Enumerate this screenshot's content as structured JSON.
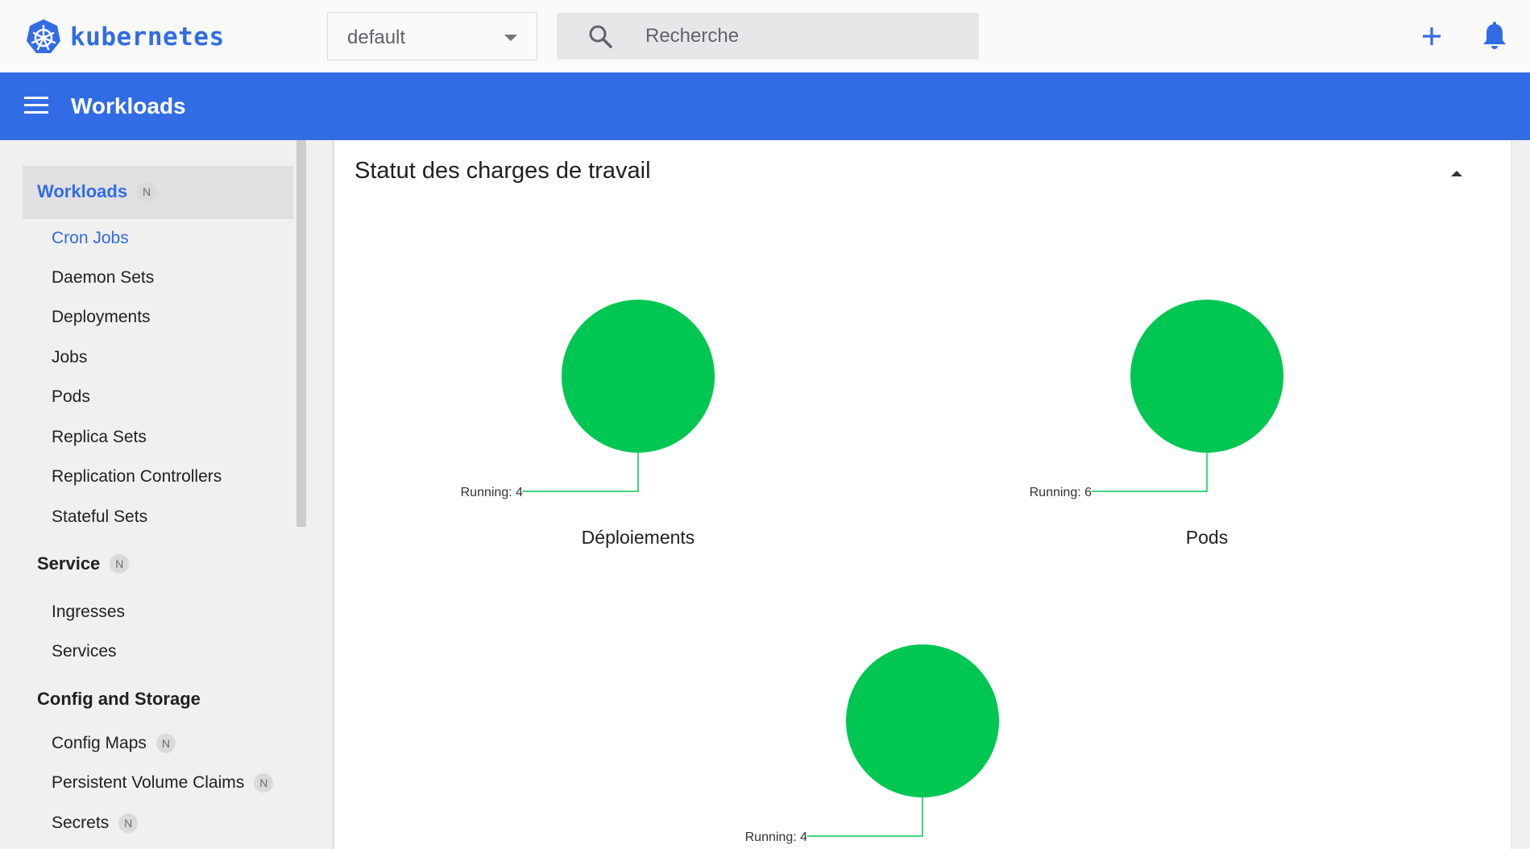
{
  "app": {
    "logo_text": "kubernetes"
  },
  "namespace": {
    "selected": "default"
  },
  "search": {
    "placeholder": "Recherche"
  },
  "header": {
    "title": "Workloads"
  },
  "sidebar": {
    "sections": [
      {
        "label": "Workloads",
        "badge": "N",
        "items": [
          "Cron Jobs",
          "Daemon Sets",
          "Deployments",
          "Jobs",
          "Pods",
          "Replica Sets",
          "Replication Controllers",
          "Stateful Sets"
        ]
      },
      {
        "label": "Service",
        "badge": "N",
        "items": [
          "Ingresses",
          "Services"
        ]
      },
      {
        "label": "Config and Storage",
        "items": [
          {
            "label": "Config Maps",
            "badge": "N"
          },
          {
            "label": "Persistent Volume Claims",
            "badge": "N"
          },
          {
            "label": "Secrets",
            "badge": "N"
          }
        ]
      }
    ]
  },
  "card": {
    "title": "Statut des charges de travail"
  },
  "colors": {
    "accent": "#326ce5",
    "running": "#00c752",
    "topbar": "#fafafa",
    "sidebar": "#f0f0f0"
  },
  "chart_data": [
    {
      "type": "pie",
      "title": "Déploiements",
      "slices": [
        {
          "label": "Running",
          "value": 4
        }
      ]
    },
    {
      "type": "pie",
      "title": "Pods",
      "slices": [
        {
          "label": "Running",
          "value": 6
        }
      ]
    },
    {
      "type": "pie",
      "title": "",
      "slices": [
        {
          "label": "Running",
          "value": 4
        }
      ]
    }
  ]
}
